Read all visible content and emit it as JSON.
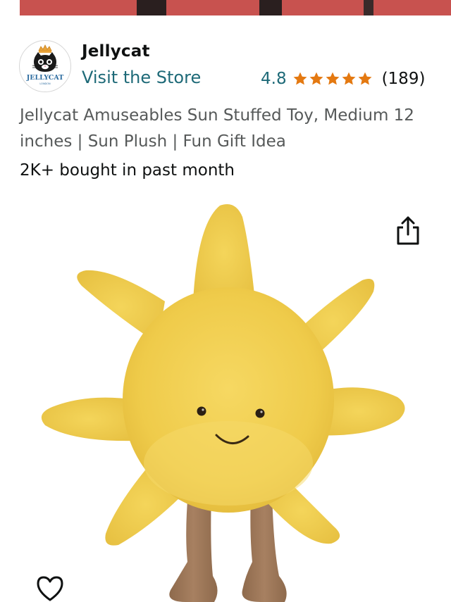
{
  "brand": {
    "name": "Jellycat",
    "logo_text": "JELLYCAT",
    "store_link": "Visit the Store"
  },
  "rating": {
    "value": "4.8",
    "stars": 5,
    "count": "(189)",
    "star_color": "#e47911"
  },
  "product": {
    "title": "Jellycat Amuseables Sun Stuffed Toy, Medium 12 inches | Sun Plush | Fun Gift Idea",
    "bought": "2K+ bought in past month",
    "image_icon": "sun-plush-image"
  },
  "icons": {
    "share": "share-icon",
    "favorite": "heart-icon"
  },
  "colors": {
    "link": "#1e6a78",
    "text": "#0f1111",
    "subtle_text": "#565959",
    "banner": "#c8524f"
  }
}
